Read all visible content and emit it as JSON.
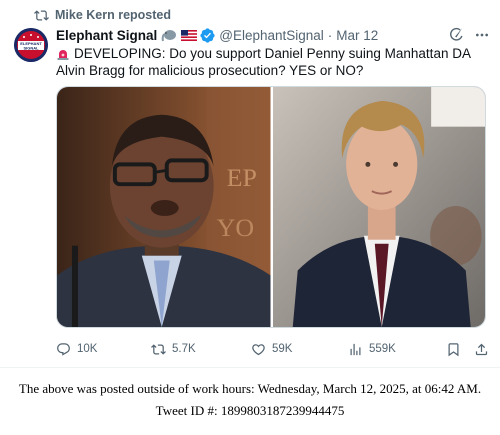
{
  "repost": {
    "icon": "repost-icon",
    "text": "Mike Kern reposted"
  },
  "post": {
    "author_name": "Elephant Signal",
    "avatar_text": "ELEPHANT SIGNAL",
    "badges": [
      "elephant-emoji",
      "us-flag-emoji",
      "verified-badge-icon"
    ],
    "handle": "@ElephantSignal",
    "separator": "·",
    "date": "Mar 12",
    "text": "DEVELOPING: Do you support Daniel Penny suing Manhattan DA Alvin Bragg for malicious prosecution? YES or NO?",
    "text_icon": "siren-emoji",
    "images": [
      {
        "description": "man in glasses speaking at microphone",
        "icon": "photo"
      },
      {
        "description": "young man in suit",
        "icon": "photo"
      }
    ]
  },
  "actions": {
    "reply_count": "10K",
    "repost_count": "5.7K",
    "like_count": "59K",
    "view_count": "559K"
  },
  "footer": {
    "line1": "The above was posted outside of work hours: Wednesday, March 12, 2025, at 06:42 AM.",
    "line2": "Tweet ID #: 1899803187239944475"
  },
  "colors": {
    "secondary_text": "#536471",
    "verified_blue": "#1d9bf0",
    "border": "#cfd9de"
  }
}
